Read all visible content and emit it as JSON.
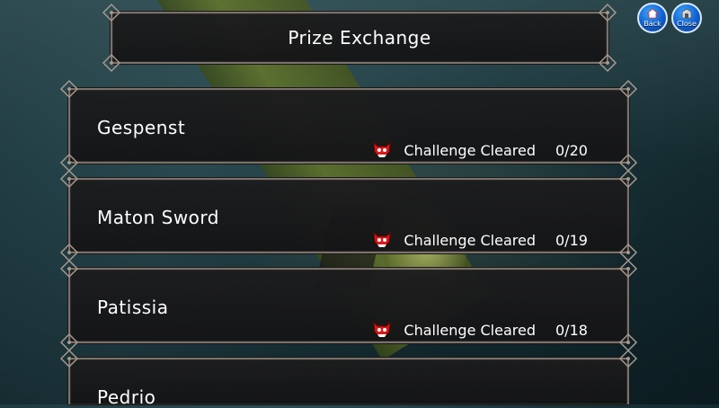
{
  "header": {
    "title": "Prize Exchange"
  },
  "hud": {
    "back_label": "Back",
    "close_label": "Close"
  },
  "items": [
    {
      "name": "Gespenst",
      "status_label": "Challenge Cleared",
      "count": "0/20"
    },
    {
      "name": "Maton Sword",
      "status_label": "Challenge Cleared",
      "count": "0/19"
    },
    {
      "name": "Patissia",
      "status_label": "Challenge Cleared",
      "count": "0/18"
    },
    {
      "name": "Pedrio",
      "status_label": "",
      "count": ""
    }
  ],
  "colors": {
    "demon_icon": "#d81a1a",
    "frame": "#7a726c",
    "hud_button": "#1a73e0"
  },
  "icons": {
    "status": "demon-face-icon",
    "back": "home-icon",
    "close": "door-icon"
  }
}
